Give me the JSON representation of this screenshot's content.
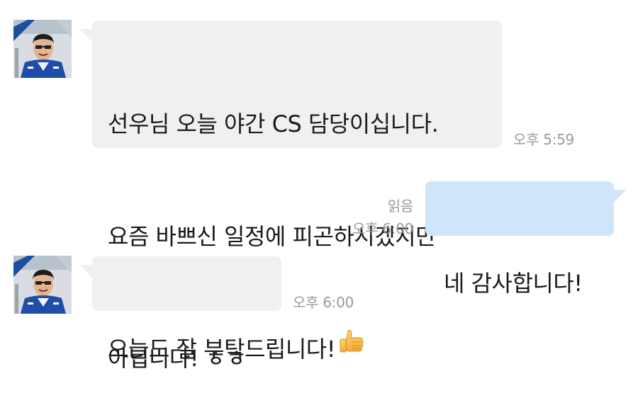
{
  "messages": [
    {
      "direction": "incoming",
      "lines": [
        "선우님 오늘 야간 CS 담당이십니다.",
        "요즘 바쁘신 일정에 피곤하시겠지만",
        "오늘도 잘 부탁드립니다!"
      ],
      "emoji": "thumbs-up-icon",
      "time": "오후 5:59"
    },
    {
      "direction": "outgoing",
      "text": "네 감사합니다!",
      "read_status": "읽음",
      "time": "오후 6:00"
    },
    {
      "direction": "incoming",
      "text": "아닙니다! ㅎㅎ",
      "time": "오후 6:00"
    }
  ],
  "colors": {
    "incoming_bubble": "#f0f0f0",
    "outgoing_bubble": "#cfe5f9",
    "meta_text": "#9a9a9a"
  }
}
